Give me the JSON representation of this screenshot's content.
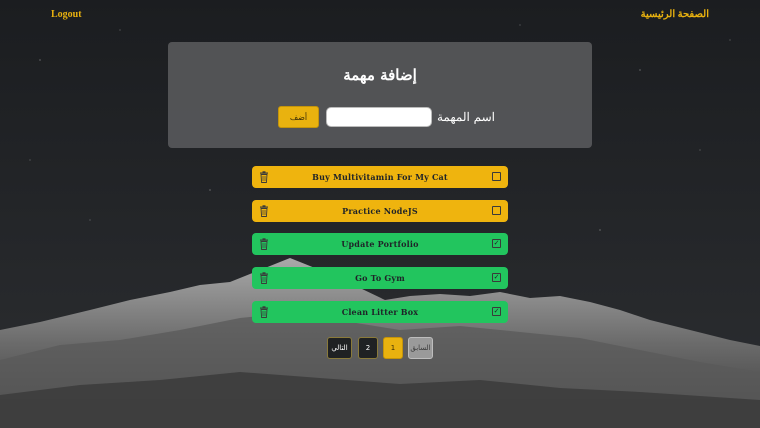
{
  "nav": {
    "logout_label": "Logout",
    "home_label": "الصفحة الرئيسية"
  },
  "form": {
    "title": "إضافة مهمة",
    "task_name_label": "اسم المهمة",
    "input_value": "",
    "input_placeholder": "",
    "add_label": "أضف"
  },
  "tasks": [
    {
      "text": "Buy Multivitamin For My Cat",
      "done": false
    },
    {
      "text": "Practice NodeJS",
      "done": false
    },
    {
      "text": "Update Portfolio",
      "done": true
    },
    {
      "text": "Go To Gym",
      "done": true
    },
    {
      "text": "Clean Litter Box",
      "done": true
    }
  ],
  "pagination": {
    "next_label": "التالي",
    "page_2": "2",
    "page_1": "1",
    "prev_label": "السابق",
    "current_page": 1
  },
  "colors": {
    "accent": "#e9b20f",
    "pending": "#efb40e",
    "done": "#22c55e",
    "panel": "#57585a"
  },
  "icons": {
    "trash": "trash-icon",
    "checkbox": "checkbox-icon"
  }
}
